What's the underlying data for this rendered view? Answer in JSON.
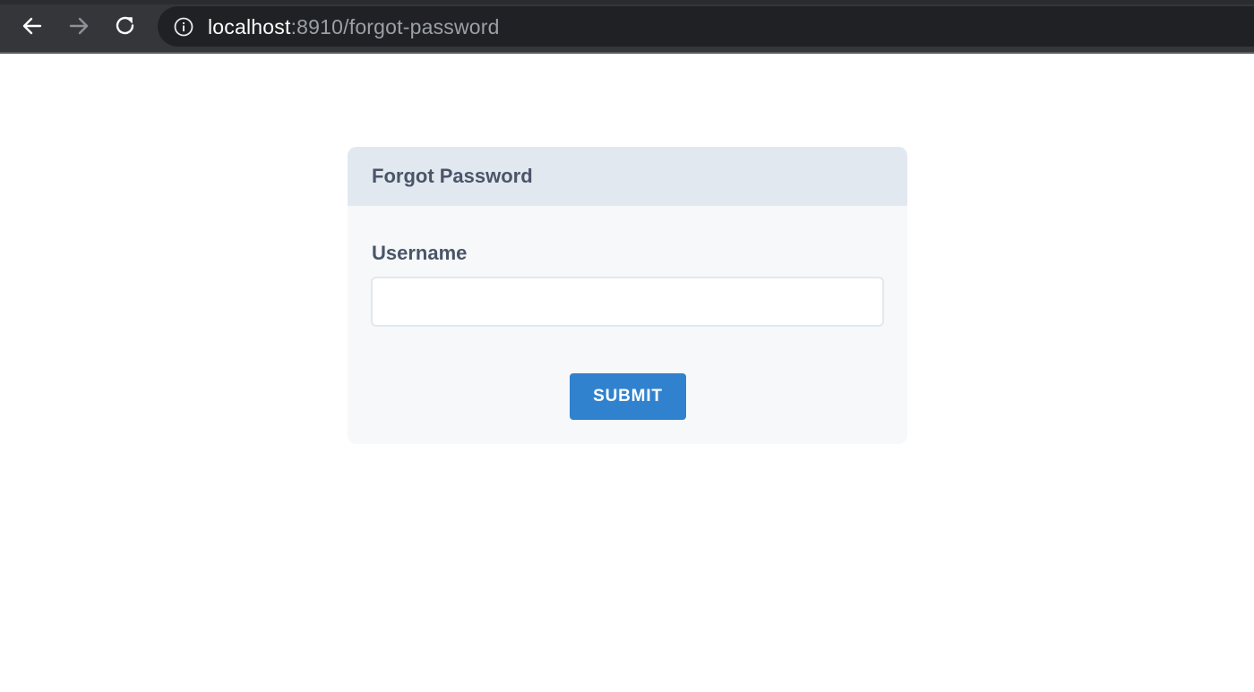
{
  "browser": {
    "url_host": "localhost",
    "url_rest": ":8910/forgot-password",
    "icons": {
      "back": "arrow-left-icon",
      "forward": "arrow-right-icon",
      "reload": "reload-icon",
      "site_info": "info-icon"
    },
    "forward_enabled": false
  },
  "form": {
    "title": "Forgot Password",
    "username_label": "Username",
    "username_value": "",
    "submit_label": "SUBMIT"
  },
  "colors": {
    "header_bg": "#e2e8f0",
    "card_bg": "#f6f8fa",
    "text": "#4a5568",
    "accent": "#3182ce"
  }
}
